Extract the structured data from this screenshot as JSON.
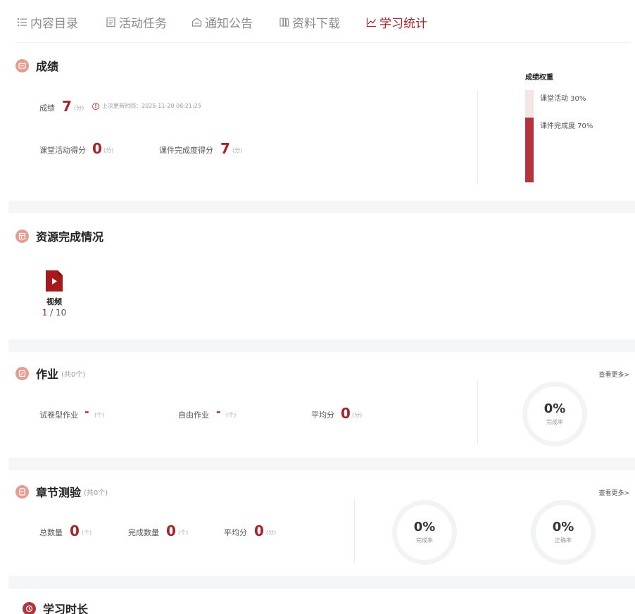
{
  "tabs": [
    {
      "label": "内容目录",
      "icon": "list-icon"
    },
    {
      "label": "活动任务",
      "icon": "task-icon"
    },
    {
      "label": "通知公告",
      "icon": "notice-icon"
    },
    {
      "label": "资料下载",
      "icon": "folder-icon"
    },
    {
      "label": "学习统计",
      "icon": "chart-line-icon",
      "active": true
    }
  ],
  "grade": {
    "title": "成绩",
    "score_label": "成绩",
    "score": "7",
    "unit": "(分)",
    "update_text": "上次更新时间：2025-11-20 08:21:25",
    "activity_label": "课堂活动得分",
    "activity_score": "0",
    "courseware_label": "课件完成度得分",
    "courseware_score": "7",
    "weight_title": "成绩权重",
    "weights": [
      {
        "label": "课堂活动 30%",
        "value": 0.3,
        "color": "#f5e6e6"
      },
      {
        "label": "课件完成度 70%",
        "value": 0.7,
        "color": "#b3343c"
      }
    ]
  },
  "resources": {
    "title": "资源完成情况",
    "item_label": "视频",
    "done": "1",
    "total": " / 10"
  },
  "homework": {
    "title": "作业",
    "count": "(共0个)",
    "more": "查看更多>",
    "exam_label": "试卷型作业",
    "exam_value": "-",
    "count_unit": "(个)",
    "free_label": "自由作业",
    "free_value": "-",
    "avg_label": "平均分",
    "avg_value": "0",
    "score_unit": "(分)",
    "rate": "0%",
    "rate_label": "完成率"
  },
  "quiz": {
    "title": "章节测验",
    "count": "(共0个)",
    "more": "查看更多>",
    "total_label": "总数量",
    "total_value": "0",
    "done_label": "完成数量",
    "done_value": "0",
    "avg_label": "平均分",
    "avg_value": "0",
    "count_unit": "(个)",
    "score_unit": "(分)",
    "completion": "0%",
    "completion_label": "完成率",
    "accuracy": "0%",
    "accuracy_label": "正确率"
  },
  "study_time": {
    "title": "学习时长"
  }
}
